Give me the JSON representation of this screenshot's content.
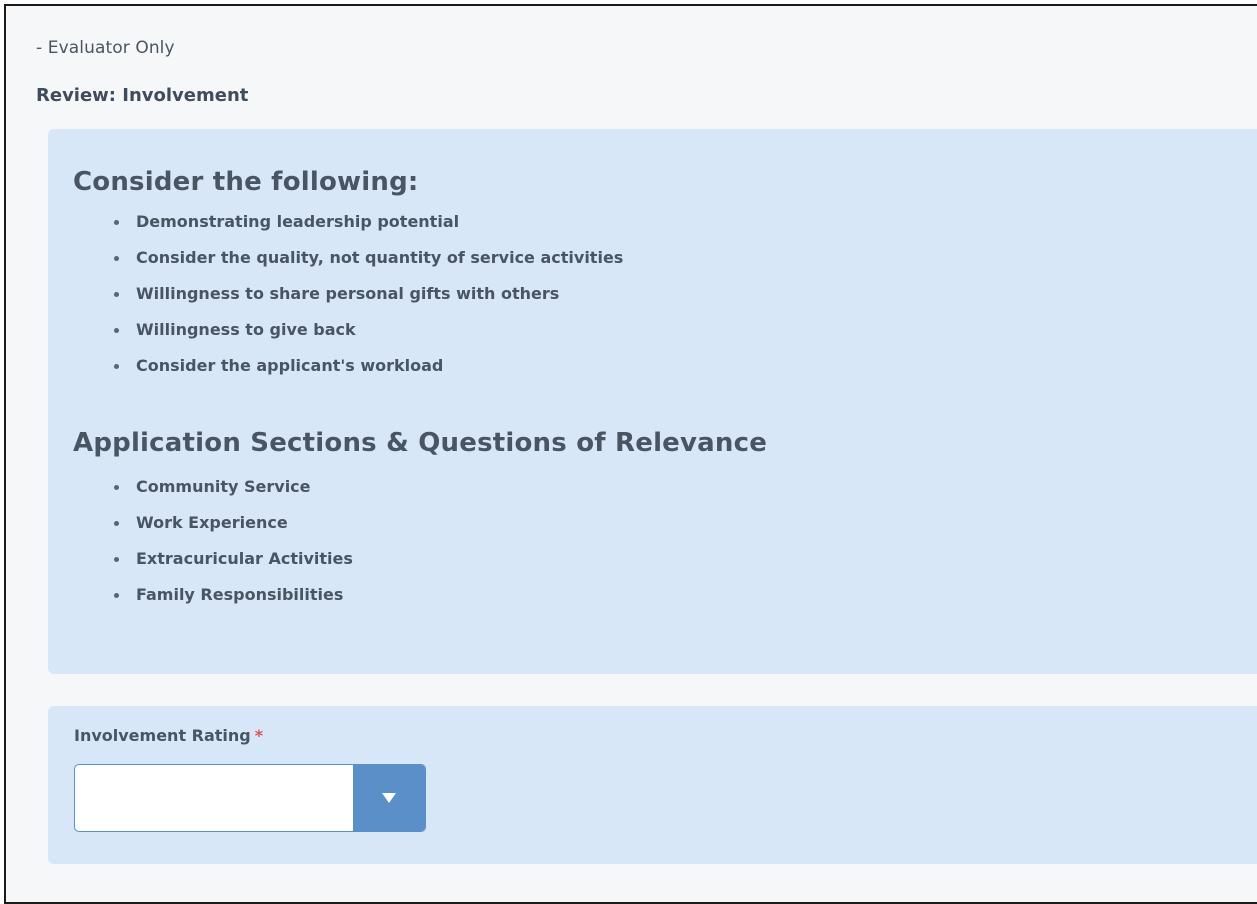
{
  "header": {
    "evaluator_note": "- Evaluator Only",
    "review_title": "Review: Involvement"
  },
  "guidance": {
    "heading_consider": "Consider the following:",
    "consider_items": [
      "Demonstrating leadership potential",
      "Consider the quality, not quantity of service activities",
      "Willingness to share personal gifts with others",
      "Willingness to give back",
      "Consider the applicant's workload"
    ],
    "heading_sections": "Application Sections & Questions of Relevance",
    "section_items": [
      "Community Service",
      "Work Experience",
      "Extracuricular Activities",
      "Family Responsibilities"
    ]
  },
  "rating": {
    "label": "Involvement Rating",
    "required_marker": "*",
    "selected_value": "",
    "dropdown_icon": "caret-down-icon"
  },
  "colors": {
    "panel_background": "#d7e7f7",
    "accent": "#5b8fc7",
    "required": "#d9534f",
    "text": "#4a5563"
  }
}
